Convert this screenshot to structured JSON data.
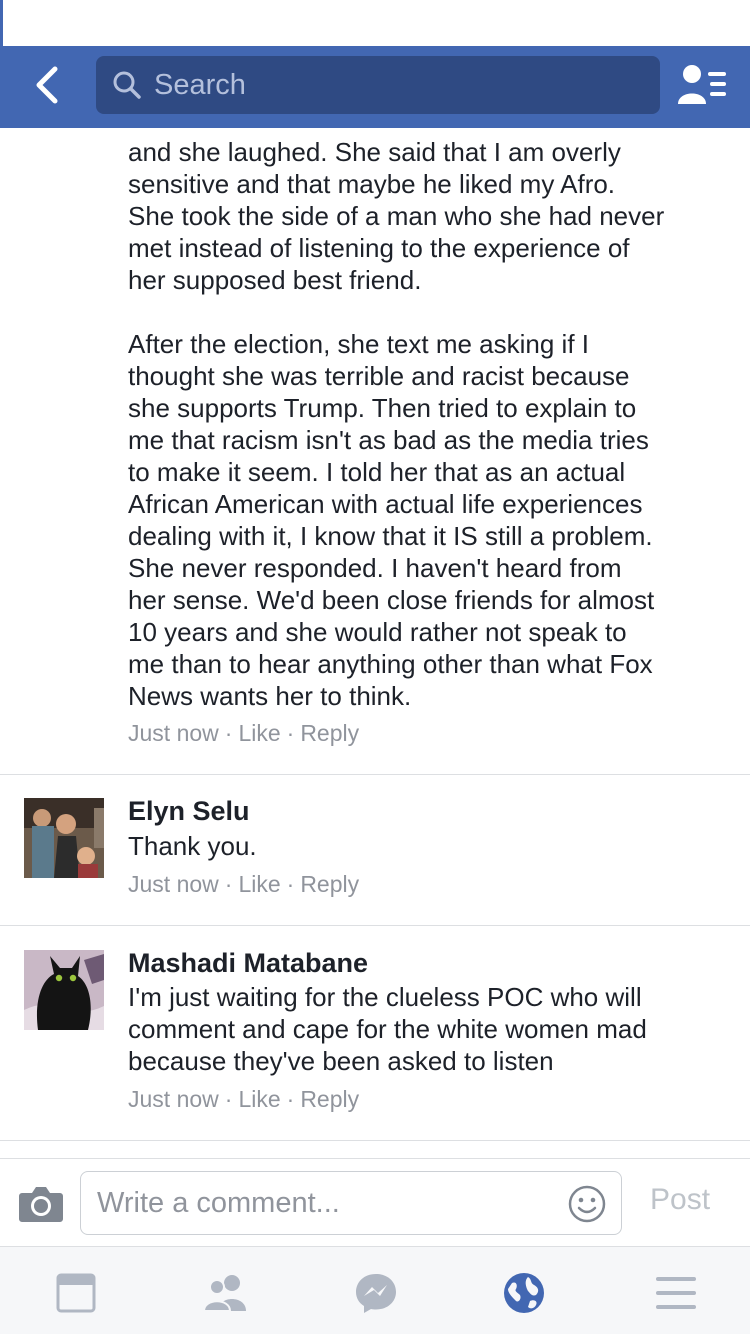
{
  "navbar": {
    "search_placeholder": "Search",
    "back_icon": "chevron-left-icon",
    "friends_icon": "friends-list-icon",
    "bg_color": "#4267b2"
  },
  "comments": [
    {
      "author": "",
      "paragraphs": [
        "and she laughed. She said that I am overly\nsensitive and that maybe he liked my Afro.\nShe took the side of a man who she had never\nmet instead of listening to the experience of\nher supposed best friend.",
        "After the election, she text me asking if I\nthought she was terrible and racist because\nshe supports Trump. Then tried to explain to\nme that racism isn't as bad as the media tries\nto make it seem. I told her that as an actual\nAfrican American with actual life experiences\ndealing with it, I know that it IS still a problem.\nShe never responded. I haven't heard from\nher sense. We'd been close friends for almost\n10 years and she would rather not speak to\nme than to hear anything other than what Fox\nNews wants her to think."
      ],
      "time": "Just now",
      "like": "Like",
      "reply": "Reply"
    },
    {
      "author": "Elyn Selu",
      "text": "Thank you.",
      "time": "Just now",
      "like": "Like",
      "reply": "Reply"
    },
    {
      "author": "Mashadi Matabane",
      "text": "I'm just waiting for the clueless POC who will\ncomment and cape for the white women mad\nbecause they've been asked to listen",
      "time": "Just now",
      "like": "Like",
      "reply": "Reply"
    }
  ],
  "composer": {
    "placeholder": "Write a comment...",
    "post_label": "Post",
    "camera_icon": "camera-icon",
    "emoji_icon": "smiley-icon"
  },
  "tabbar": {
    "items": [
      "news-feed-icon",
      "friend-requests-icon",
      "messenger-icon",
      "globe-notifications-icon",
      "menu-icon"
    ],
    "active_color": "#4267b2",
    "inactive_color": "#b0b7c3"
  }
}
